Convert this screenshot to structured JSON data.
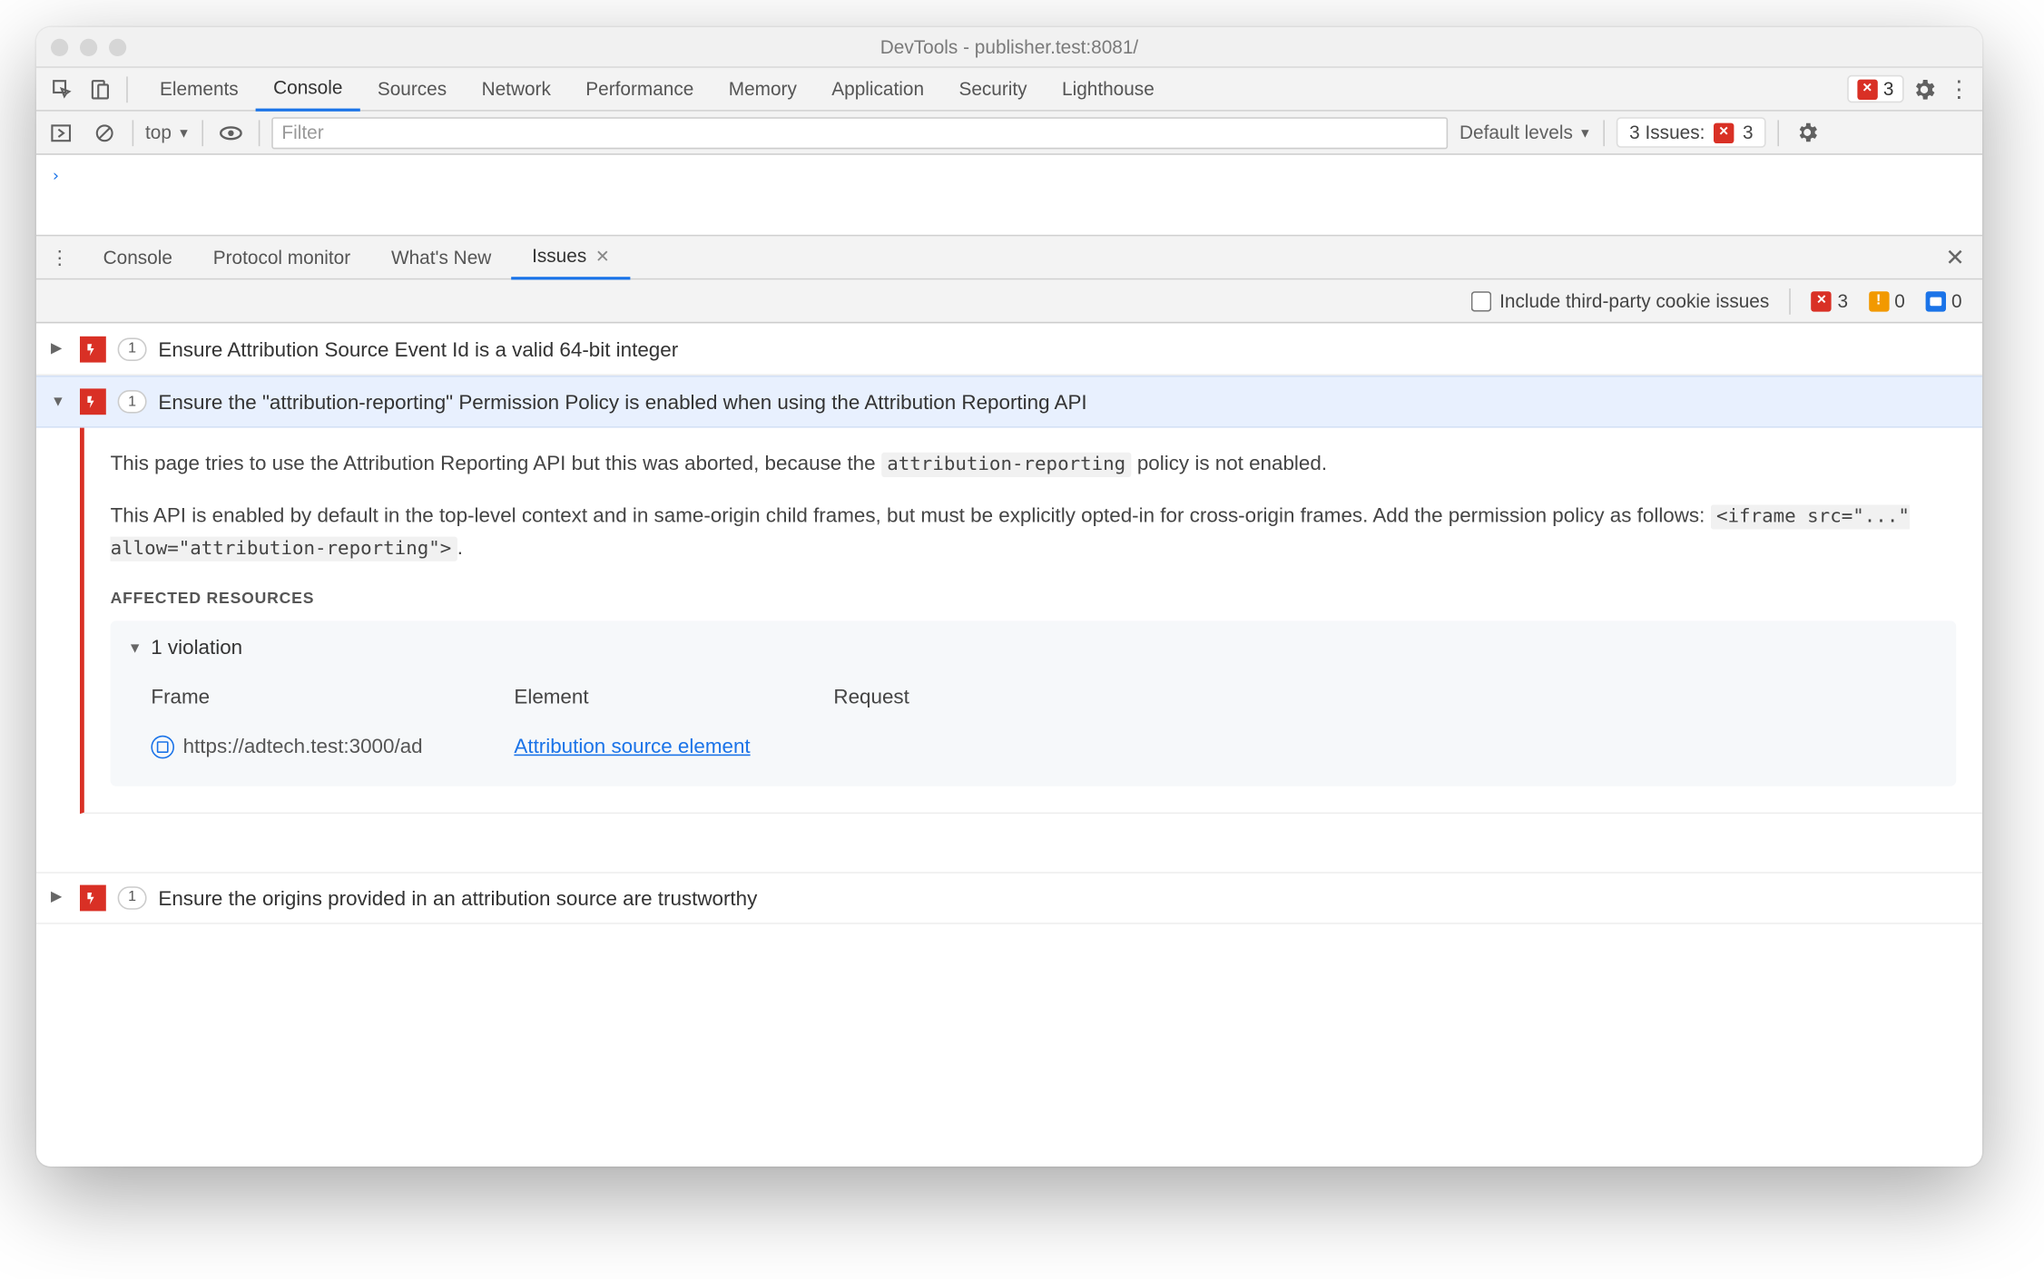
{
  "window": {
    "title": "DevTools - publisher.test:8081/"
  },
  "mainTabs": [
    "Elements",
    "Console",
    "Sources",
    "Network",
    "Performance",
    "Memory",
    "Application",
    "Security",
    "Lighthouse"
  ],
  "mainActive": "Console",
  "topErrorCount": "3",
  "consoleBar": {
    "context": "top",
    "filterPlaceholder": "Filter",
    "levels": "Default levels",
    "issuesLabel": "3 Issues:",
    "issuesCount": "3"
  },
  "drawerTabs": [
    "Console",
    "Protocol monitor",
    "What's New",
    "Issues"
  ],
  "drawerActive": "Issues",
  "issuesBar": {
    "includeLabel": "Include third-party cookie issues",
    "errors": "3",
    "warnings": "0",
    "info": "0"
  },
  "issues": [
    {
      "count": "1",
      "title": "Ensure Attribution Source Event Id is a valid 64-bit integer",
      "expanded": false
    },
    {
      "count": "1",
      "title": "Ensure the \"attribution-reporting\" Permission Policy is enabled when using the Attribution Reporting API",
      "expanded": true
    },
    {
      "count": "1",
      "title": "Ensure the origins provided in an attribution source are trustworthy",
      "expanded": false
    }
  ],
  "detail": {
    "p1a": "This page tries to use the Attribution Reporting API but this was aborted, because the ",
    "p1code": "attribution-reporting",
    "p1b": " policy is not enabled.",
    "p2a": "This API is enabled by default in the top-level context and in same-origin child frames, but must be explicitly opted-in for cross-origin frames. Add the permission policy as follows: ",
    "p2code": "<iframe src=\"...\" allow=\"attribution-reporting\">",
    "p2b": ".",
    "affectedLabel": "Affected Resources",
    "violationLabel": "1 violation",
    "cols": {
      "frame": "Frame",
      "element": "Element",
      "request": "Request"
    },
    "row": {
      "frame": "https://adtech.test:3000/ad",
      "element": "Attribution source element",
      "request": ""
    }
  }
}
